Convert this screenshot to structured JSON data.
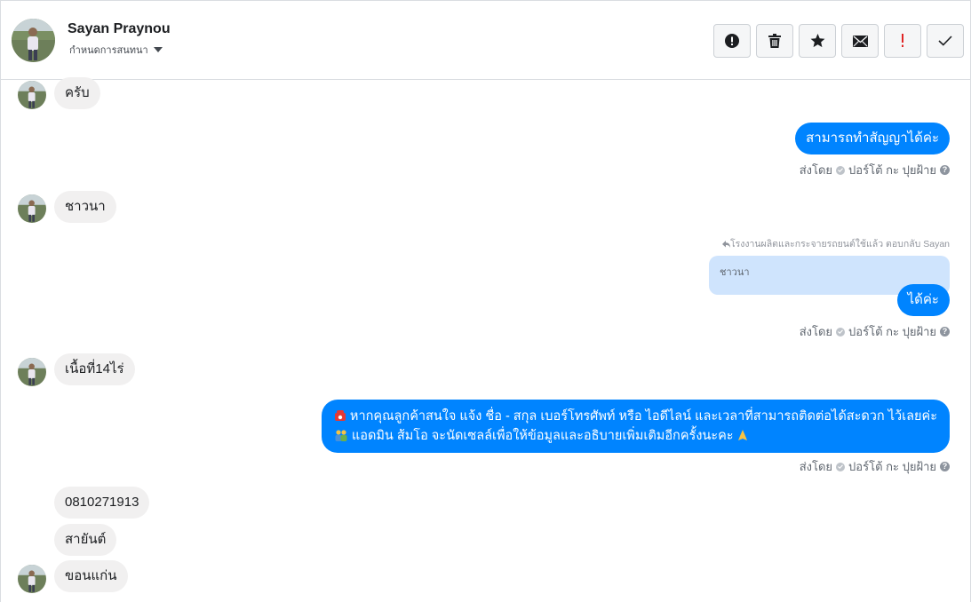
{
  "header": {
    "contact_name": "Sayan Praynou",
    "assign_label": "กำหนดการสนทนา",
    "toolbar": [
      {
        "name": "spam-button",
        "icon": "alert-circle-icon"
      },
      {
        "name": "delete-button",
        "icon": "trash-icon"
      },
      {
        "name": "star-button",
        "icon": "star-icon"
      },
      {
        "name": "mark-unread-button",
        "icon": "envelope-icon"
      },
      {
        "name": "follow-up-button",
        "icon": "exclamation-icon"
      },
      {
        "name": "mark-done-button",
        "icon": "checkmark-icon"
      }
    ]
  },
  "messages": {
    "m1": "ครับ",
    "m2": "สามารถทำสัญญาได้ค่ะ",
    "m2_sender_prefix": "ส่งโดย",
    "m2_sender_name": "ปอร์โต้ กะ ปุยฝ้าย",
    "m3": "ชาวนา",
    "m4_reply_note": "โรงงานผลิตและกระจายรถยนต์ใช้แล้ว ตอบกลับ Sayan",
    "m4_quote": "ชาวนา",
    "m4": "ได้ค่ะ",
    "m4_sender_prefix": "ส่งโดย",
    "m4_sender_name": "ปอร์โต้ กะ ปุยฝ้าย",
    "m5": "เนื้อที่14ไร่",
    "m6_line1": "หากคุณลูกค้าสนใจ แจ้ง ชื่อ - สกุล เบอร์โทรศัพท์ หรือ ไอดีไลน์ และเวลาที่สามารถติดต่อได้สะดวก ไว้เลยค่ะ",
    "m6_line2": "แอดมิน ส้มโอ จะนัดเซลล์เพื่อให้ข้อมูลและอธิบายเพิ่มเติมอีกครั้งนะคะ",
    "m6_sender_prefix": "ส่งโดย",
    "m6_sender_name": "ปอร์โต้ กะ ปุยฝ้าย",
    "m7": "0810271913",
    "m8": "สายันต์",
    "m9": "ขอนแก่น"
  },
  "colors": {
    "outgoing_bubble": "#0084ff",
    "incoming_bubble": "#f1f0f0",
    "quote_bubble": "#cfe4fd"
  }
}
